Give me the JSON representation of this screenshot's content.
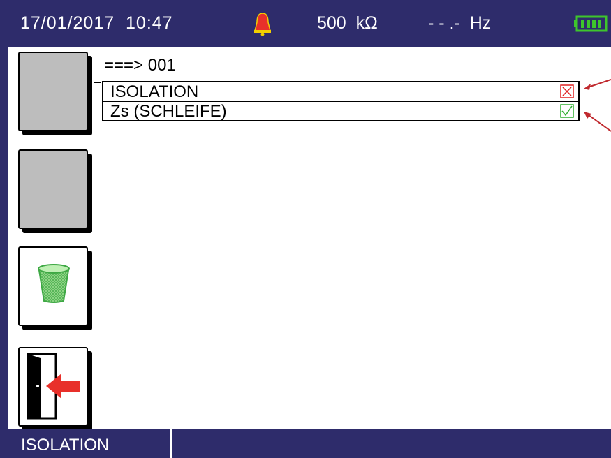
{
  "header": {
    "datetime": "17/01/2017  10:47",
    "resistance": "500  kΩ",
    "frequency": "- - .-  Hz",
    "alarm_icon": "bell-icon",
    "battery_icon": "battery-full-icon",
    "alarm_color": "#e8302a",
    "battery_color": "#3ec62c"
  },
  "prompt": "===> 001",
  "tests": [
    {
      "label": "ISOLATION",
      "status": "fail",
      "status_icon": "checkbox-cross-icon",
      "status_color": "#e02020"
    },
    {
      "label": "Zs (SCHLEIFE)",
      "status": "pass",
      "status_icon": "checkbox-check-icon",
      "status_color": "#2fae2f"
    }
  ],
  "softkeys": [
    {
      "name": "softkey-1",
      "icon": "blank"
    },
    {
      "name": "softkey-2",
      "icon": "blank"
    },
    {
      "name": "softkey-3",
      "icon": "trash-icon"
    },
    {
      "name": "softkey-4",
      "icon": "exit-door-icon"
    }
  ],
  "footer": {
    "mode": "ISOLATION"
  },
  "colors": {
    "bar": "#2e2c6b",
    "key_grey": "#bdbdbd",
    "callout": "#c0282d"
  }
}
